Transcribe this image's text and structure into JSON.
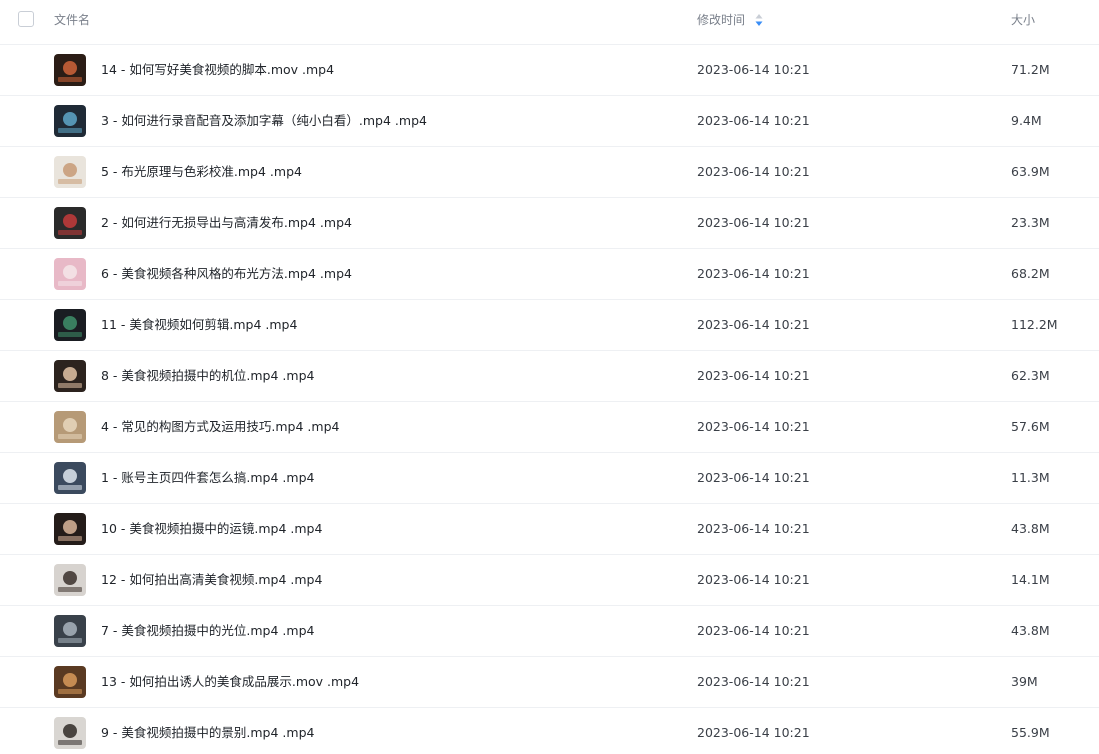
{
  "header": {
    "name_label": "文件名",
    "time_label": "修改时间",
    "size_label": "大小",
    "sort_icon": "sort-icon",
    "sort_color": "#3a8ef6"
  },
  "files": [
    {
      "name": "14 - 如何写好美食视频的脚本.mov .mp4",
      "time": "2023-06-14 10:21",
      "size": "71.2M",
      "thumb": {
        "bg": "#2b1d16",
        "fg": "#d0643a"
      }
    },
    {
      "name": "3 - 如何进行录音配音及添加字幕（纯小白看）.mp4 .mp4",
      "time": "2023-06-14 10:21",
      "size": "9.4M",
      "thumb": {
        "bg": "#1f2a36",
        "fg": "#5fa7c9"
      }
    },
    {
      "name": "5 - 布光原理与色彩校准.mp4 .mp4",
      "time": "2023-06-14 10:21",
      "size": "63.9M",
      "thumb": {
        "bg": "#e9e4dc",
        "fg": "#c79a75"
      }
    },
    {
      "name": "2 - 如何进行无损导出与高清发布.mp4 .mp4",
      "time": "2023-06-14 10:21",
      "size": "23.3M",
      "thumb": {
        "bg": "#2a2a2a",
        "fg": "#c43b3b"
      }
    },
    {
      "name": "6 - 美食视频各种风格的布光方法.mp4 .mp4",
      "time": "2023-06-14 10:21",
      "size": "68.2M",
      "thumb": {
        "bg": "#e8b9c7",
        "fg": "#f4e6e9"
      }
    },
    {
      "name": "11 - 美食视频如何剪辑.mp4 .mp4",
      "time": "2023-06-14 10:21",
      "size": "112.2M",
      "thumb": {
        "bg": "#1a1d22",
        "fg": "#3f8f6a"
      }
    },
    {
      "name": "8 - 美食视频拍摄中的机位.mp4 .mp4",
      "time": "2023-06-14 10:21",
      "size": "62.3M",
      "thumb": {
        "bg": "#2c231e",
        "fg": "#e3c3a6"
      }
    },
    {
      "name": "4 - 常见的构图方式及运用技巧.mp4 .mp4",
      "time": "2023-06-14 10:21",
      "size": "57.6M",
      "thumb": {
        "bg": "#b69a77",
        "fg": "#e8d7bd"
      }
    },
    {
      "name": "1 - 账号主页四件套怎么搞.mp4 .mp4",
      "time": "2023-06-14 10:21",
      "size": "11.3M",
      "thumb": {
        "bg": "#3b4a5e",
        "fg": "#dfe6ee"
      }
    },
    {
      "name": "10 - 美食视频拍摄中的运镜.mp4 .mp4",
      "time": "2023-06-14 10:21",
      "size": "43.8M",
      "thumb": {
        "bg": "#241c19",
        "fg": "#d9b59a"
      }
    },
    {
      "name": "12 - 如何拍出高清美食视频.mp4 .mp4",
      "time": "2023-06-14 10:21",
      "size": "14.1M",
      "thumb": {
        "bg": "#d7d3cf",
        "fg": "#3a2f2a"
      }
    },
    {
      "name": "7 - 美食视频拍摄中的光位.mp4 .mp4",
      "time": "2023-06-14 10:21",
      "size": "43.8M",
      "thumb": {
        "bg": "#39414a",
        "fg": "#a9b4bd"
      }
    },
    {
      "name": "13 - 如何拍出诱人的美食成品展示.mov .mp4",
      "time": "2023-06-14 10:21",
      "size": "39M",
      "thumb": {
        "bg": "#5a3a22",
        "fg": "#d89a5b"
      }
    },
    {
      "name": "9 - 美食视频拍摄中的景别.mp4 .mp4",
      "time": "2023-06-14 10:21",
      "size": "55.9M",
      "thumb": {
        "bg": "#d9d6d2",
        "fg": "#2f2a27"
      }
    }
  ]
}
